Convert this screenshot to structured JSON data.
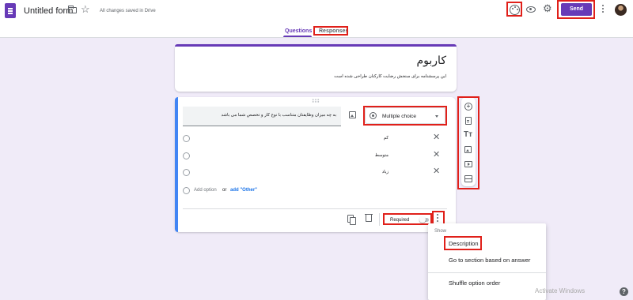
{
  "header": {
    "title": "Untitled form",
    "save_status": "All changes saved in Drive",
    "send_label": "Send"
  },
  "tabs": [
    {
      "label": "Questions",
      "active": true
    },
    {
      "label": "Responses",
      "active": false
    }
  ],
  "form": {
    "title": "کاربوم",
    "description": "این پرسشنامه برای سنجش رضایت کارکنان طراحی شده است"
  },
  "question": {
    "text": "به چه میزان وظایفتان متناسب با نوع کار و تخصص شما می باشد",
    "type_label": "Multiple choice",
    "options": [
      "کم",
      "متوسط",
      "زیاد"
    ],
    "add_option_label": "Add option",
    "or_label": "or",
    "add_other_label": "add \"Other\"",
    "required_label": "Required",
    "required": false
  },
  "sidebar": {
    "text_tool_label": "Tт"
  },
  "menu": {
    "header": "Show",
    "items": [
      "Description",
      "Go to section based on answer",
      "Shuffle option order"
    ]
  },
  "watermark": "Activate Windows",
  "help_label": "?",
  "colors": {
    "accent": "#673ab7",
    "background": "#f0ebf8",
    "question_focus": "#4285f4",
    "link": "#1a73e8",
    "annotation": "#e0201a"
  },
  "icons": [
    "forms-app-icon",
    "folder-icon",
    "star-icon",
    "palette-icon",
    "eye-icon",
    "gear-icon",
    "more-vert-icon",
    "avatar",
    "image-icon",
    "radio-icon",
    "caret-down-icon",
    "close-icon",
    "copy-icon",
    "trash-icon",
    "add-circle-icon",
    "import-icon",
    "text-icon",
    "video-icon",
    "section-icon",
    "help-icon"
  ]
}
